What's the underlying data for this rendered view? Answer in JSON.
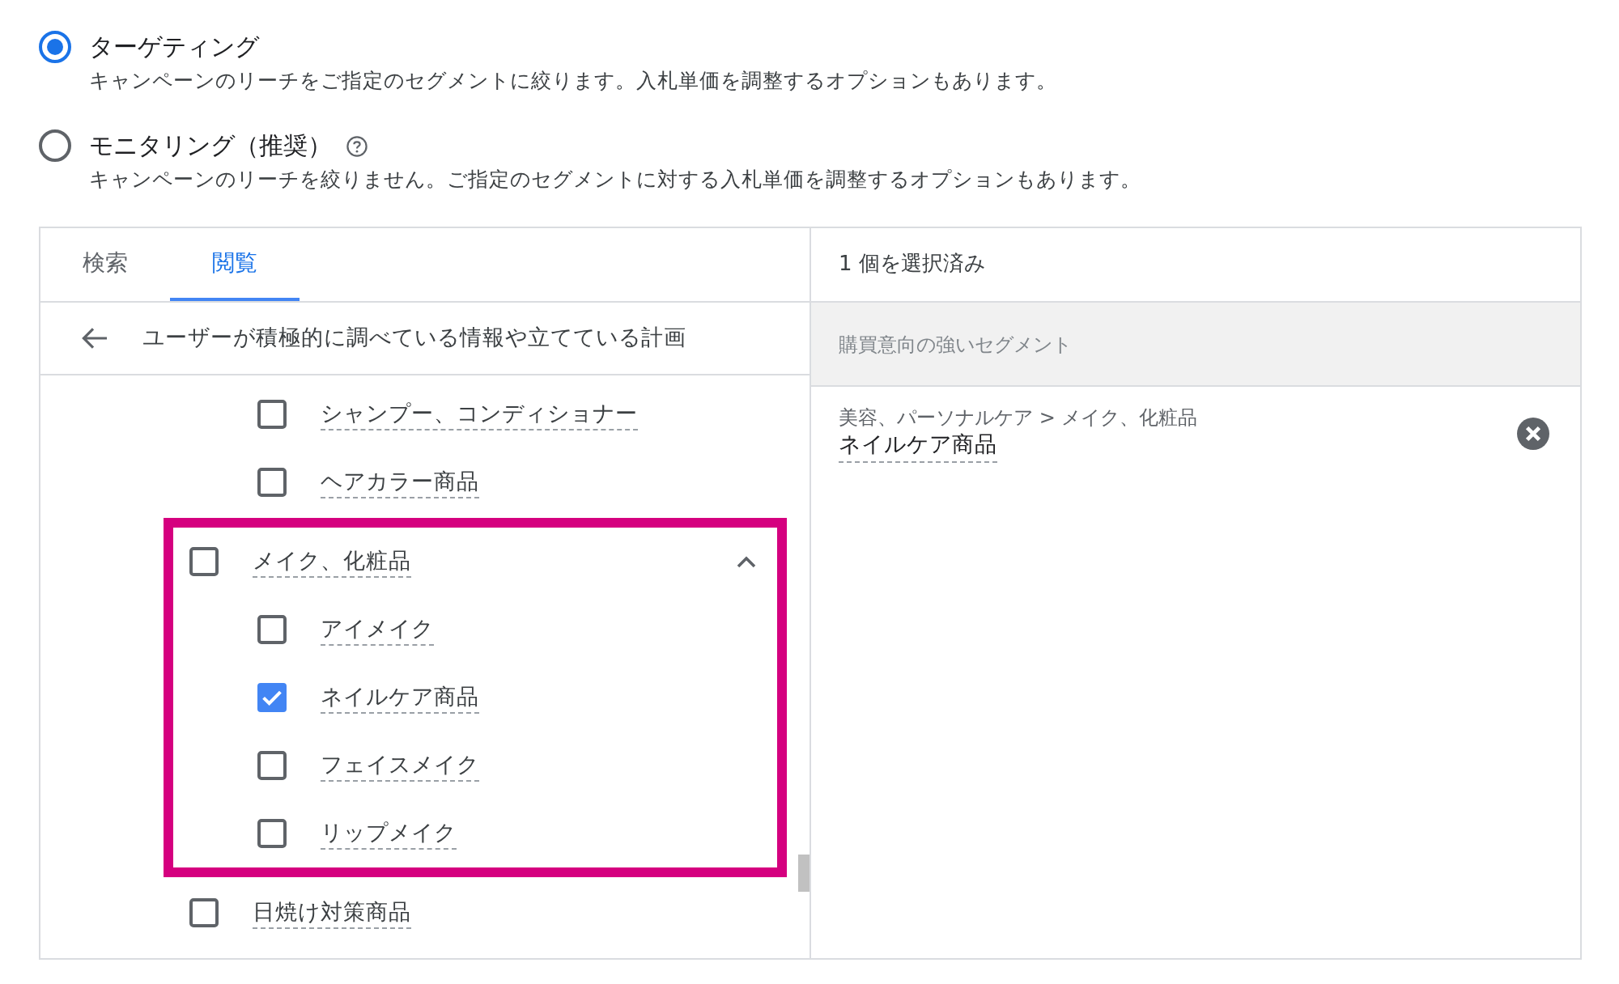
{
  "targeting_options": [
    {
      "label": "ターゲティング",
      "description": "キャンペーンのリーチをご指定のセグメントに絞ります。入札単価を調整するオプションもあります。",
      "selected": true,
      "help": false
    },
    {
      "label": "モニタリング（推奨）",
      "description": "キャンペーンのリーチを絞りません。ご指定のセグメントに対する入札単価を調整するオプションもあります。",
      "selected": false,
      "help": true
    }
  ],
  "segment_picker": {
    "tabs": [
      {
        "label": "検索",
        "selected": false
      },
      {
        "label": "閲覧",
        "selected": true
      }
    ],
    "breadcrumb": "ユーザーが積極的に調べている情報や立てている計画",
    "segments": [
      {
        "highlighted": false,
        "children": [
          {
            "label": "シャンプー、コンディショナー",
            "checked": false
          },
          {
            "label": "ヘアカラー商品",
            "checked": false
          }
        ]
      },
      {
        "label": "メイク、化粧品",
        "checked": false,
        "expanded": true,
        "highlighted": true,
        "children": [
          {
            "label": "アイメイク",
            "checked": false
          },
          {
            "label": "ネイルケア商品",
            "checked": true
          },
          {
            "label": "フェイスメイク",
            "checked": false
          },
          {
            "label": "リップメイク",
            "checked": false
          }
        ]
      },
      {
        "label": "日焼け対策商品",
        "checked": false,
        "highlighted": false
      }
    ],
    "selected_count": "1 個を選択済み",
    "selected_group": "購買意向の強いセグメント",
    "selected_segments": [
      {
        "path": "美容、パーソナルケア > メイク、化粧品",
        "label": "ネイルケア商品"
      }
    ]
  }
}
